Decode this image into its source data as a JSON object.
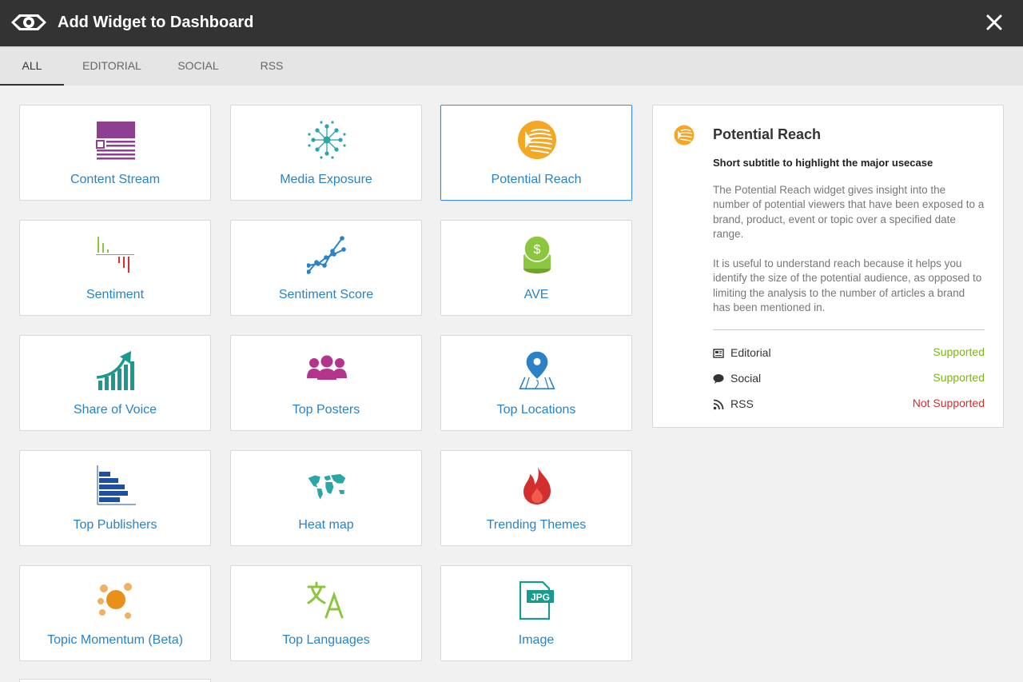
{
  "window": {
    "title": "Add Widget to Dashboard"
  },
  "tabs": [
    {
      "label": "ALL",
      "active": true
    },
    {
      "label": "EDITORIAL",
      "active": false
    },
    {
      "label": "SOCIAL",
      "active": false
    },
    {
      "label": "RSS",
      "active": false
    }
  ],
  "widgets": [
    {
      "label": "Content Stream",
      "icon": "content-stream-icon"
    },
    {
      "label": "Media Exposure",
      "icon": "media-exposure-icon"
    },
    {
      "label": "Potential Reach",
      "icon": "potential-reach-icon",
      "selected": true
    },
    {
      "label": "Sentiment",
      "icon": "sentiment-icon"
    },
    {
      "label": "Sentiment Score",
      "icon": "sentiment-score-icon"
    },
    {
      "label": "AVE",
      "icon": "ave-coins-icon"
    },
    {
      "label": "Share of Voice",
      "icon": "share-of-voice-icon"
    },
    {
      "label": "Top Posters",
      "icon": "top-posters-icon"
    },
    {
      "label": "Top Locations",
      "icon": "top-locations-icon"
    },
    {
      "label": "Top Publishers",
      "icon": "top-publishers-icon"
    },
    {
      "label": "Heat map",
      "icon": "heat-map-icon"
    },
    {
      "label": "Trending Themes",
      "icon": "trending-themes-flame-icon"
    },
    {
      "label": "Topic Momentum (Beta)",
      "icon": "topic-momentum-icon"
    },
    {
      "label": "Top Languages",
      "icon": "top-languages-icon"
    },
    {
      "label": "Image",
      "icon": "image-jpg-icon"
    }
  ],
  "detail": {
    "title": "Potential Reach",
    "subtitle": "Short subtitle to highlight the major usecase",
    "paragraph1": "The Potential Reach widget gives insight into the number of potential viewers that have been exposed to a brand, product, event or topic over a specified date range.",
    "paragraph2": "It is useful to understand reach because it helps you identify the size of the potential audience, as opposed to limiting the analysis to the number of articles a brand has been mentioned in.",
    "support": [
      {
        "name": "Editorial",
        "status": "Supported",
        "icon": "newspaper-icon"
      },
      {
        "name": "Social",
        "status": "Supported",
        "icon": "chat-bubble-icon"
      },
      {
        "name": "RSS",
        "status": "Not Supported",
        "icon": "rss-icon"
      }
    ]
  },
  "colors": {
    "titlebar": "#333333",
    "link_blue": "#2b82c7",
    "supported": "#7cb518",
    "not_supported": "#d0312d",
    "reach_orange": "#f5a623"
  }
}
